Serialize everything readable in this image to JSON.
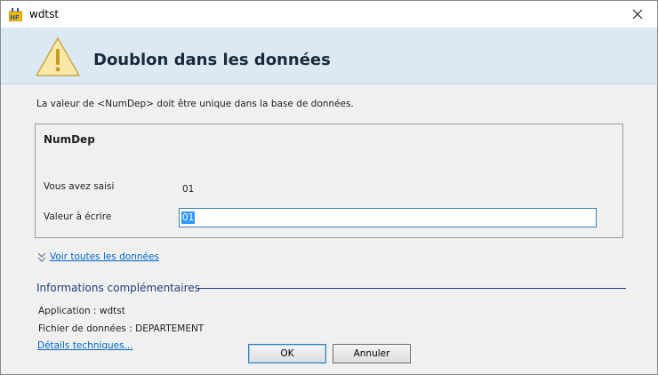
{
  "window": {
    "title": "wdtst"
  },
  "header": {
    "title": "Doublon dans les données"
  },
  "message": "La valeur de <NumDep> doit être unique dans la base de données.",
  "field_group": {
    "title": "NumDep",
    "entered_label": "Vous avez saisi",
    "entered_value": "01",
    "write_label": "Valeur à écrire",
    "write_value": "01"
  },
  "expand": {
    "label": "Voir toutes les données"
  },
  "info": {
    "title": "Informations complémentaires",
    "application": "Application : wdtst",
    "data_file": "Fichier de données : DEPARTEMENT",
    "technical_details": "Détails techniques..."
  },
  "buttons": {
    "ok": "OK",
    "cancel": "Annuler"
  },
  "icons": {
    "app": "windev-app-icon",
    "warning": "warning-icon",
    "close": "close-icon",
    "expand": "double-chevron-down-icon"
  },
  "colors": {
    "header_bg": "#dbe9f5",
    "link": "#0066cc",
    "info_title": "#1f3e79",
    "selection": "#3399ff"
  }
}
